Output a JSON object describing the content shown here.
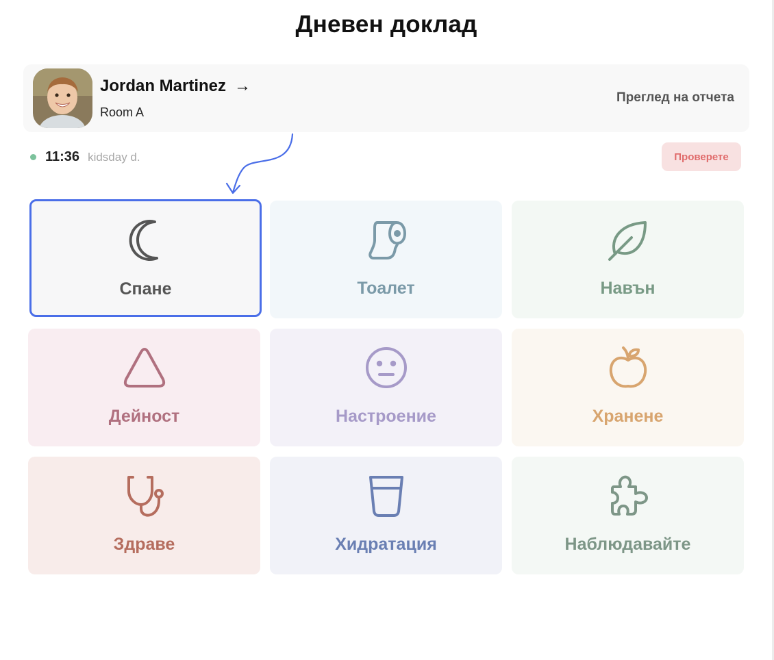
{
  "header": {
    "title": "Дневен доклад"
  },
  "child": {
    "name": "Jordan Martinez",
    "arrow": "→",
    "room": "Room A",
    "view_report": "Преглед на отчета"
  },
  "status": {
    "time": "11:36",
    "subtitle": "kidsday d.",
    "check_label": "Проверете"
  },
  "categories": [
    {
      "label": "Спане",
      "icon": "moon-icon",
      "color": "#555555",
      "bg": "#f7f7f8",
      "selected": true
    },
    {
      "label": "Тоалет",
      "icon": "toilet-paper-icon",
      "color": "#7b9aa8",
      "bg": "#f2f7fa"
    },
    {
      "label": "Навън",
      "icon": "leaf-icon",
      "color": "#789a85",
      "bg": "#f3f8f4"
    },
    {
      "label": "Дейност",
      "icon": "triangle-icon",
      "color": "#b0707f",
      "bg": "#f9edf1"
    },
    {
      "label": "Настроение",
      "icon": "neutral-face-icon",
      "color": "#a69ac8",
      "bg": "#f3f1f8"
    },
    {
      "label": "Хранене",
      "icon": "apple-icon",
      "color": "#d8a56f",
      "bg": "#fbf7f1"
    },
    {
      "label": "Здраве",
      "icon": "stethoscope-icon",
      "color": "#b56d5e",
      "bg": "#f8ecea"
    },
    {
      "label": "Хидратация",
      "icon": "glass-icon",
      "color": "#6a7fb3",
      "bg": "#f1f2f8"
    },
    {
      "label": "Наблюдавайте",
      "icon": "puzzle-icon",
      "color": "#7d9687",
      "bg": "#f4f8f5"
    }
  ],
  "colors": {
    "accent": "#4a6ee8",
    "status_dot": "#7cc29c",
    "check_bg": "#f8e1e1",
    "check_text": "#e06b6b"
  }
}
